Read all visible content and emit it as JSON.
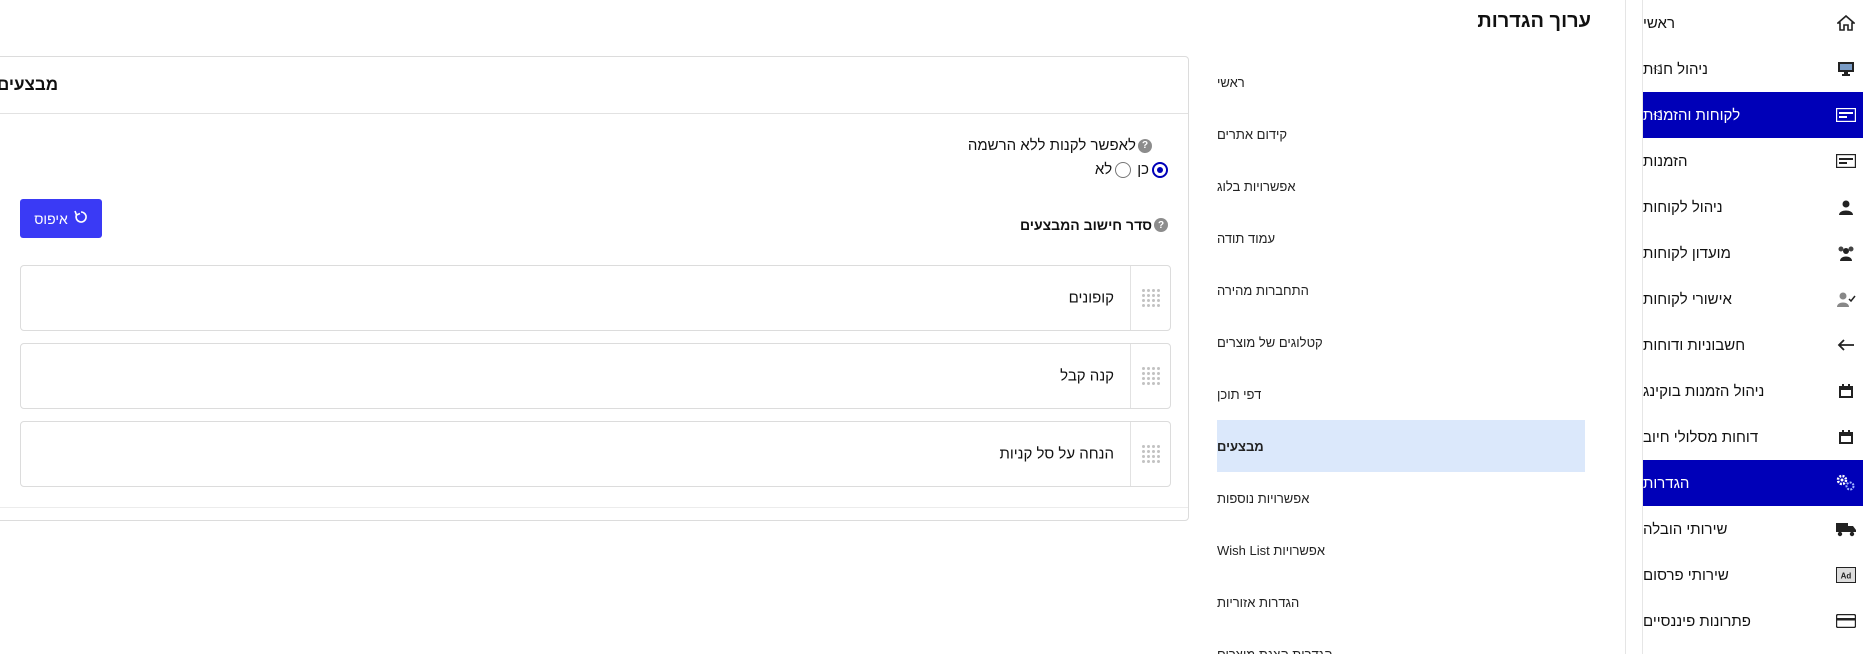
{
  "sidebar": {
    "items": [
      {
        "label": "ראשי",
        "icon": "home-icon",
        "active": false
      },
      {
        "label": "ניהול חנות",
        "icon": "monitor-icon",
        "active": false,
        "arrow": true
      },
      {
        "label": "לקוחות והזמנות",
        "icon": "id-card-icon",
        "active": true,
        "arrow": true
      },
      {
        "label": "הזמנות",
        "icon": "id-card-icon",
        "active": false
      },
      {
        "label": "ניהול לקוחות",
        "icon": "user-icon",
        "active": false
      },
      {
        "label": "מועדון לקוחות",
        "icon": "users-icon",
        "active": false
      },
      {
        "label": "אישורי לקוחות",
        "icon": "user-check-icon",
        "active": false
      },
      {
        "label": "חשבוניות ודוחות",
        "icon": "arrow-left-icon",
        "active": false
      },
      {
        "label": "ניהול הזמנות בוקינג",
        "icon": "calendar-icon",
        "active": false
      },
      {
        "label": "דוחות מסלולי חיוב",
        "icon": "calendar-icon",
        "active": false
      },
      {
        "label": "הגדרות",
        "icon": "gears-icon",
        "active": true
      },
      {
        "label": "שירותי הובלה",
        "icon": "truck-icon",
        "active": false
      },
      {
        "label": "שירותי פרסום",
        "icon": "ad-icon",
        "active": false
      },
      {
        "label": "פתרונות פיננסיים",
        "icon": "credit-card-icon",
        "active": false
      }
    ]
  },
  "page": {
    "title": "ערוך הגדרות"
  },
  "settings_nav": {
    "items": [
      {
        "label": "ראשי",
        "active": false
      },
      {
        "label": "קידום אתרים",
        "active": false
      },
      {
        "label": "אפשרויות בלוג",
        "active": false
      },
      {
        "label": "עמוד תודה",
        "active": false
      },
      {
        "label": "התחברות מהירה",
        "active": false
      },
      {
        "label": "קטלוגים של מוצרים",
        "active": false
      },
      {
        "label": "דפי תוכן",
        "active": false
      },
      {
        "label": "מבצעים",
        "active": true
      },
      {
        "label": "אפשרויות נוספות",
        "active": false
      },
      {
        "label": "אפשרויות Wish List",
        "active": false
      },
      {
        "label": "הגדרות אזוריות",
        "active": false
      },
      {
        "label": "הגדרות הצגת מוצרים",
        "active": false
      }
    ]
  },
  "panel": {
    "title": "מבצעים",
    "guest_purchase": {
      "label": "לאפשר לקנות ללא הרשמה",
      "help": "?",
      "options": [
        {
          "label": "כן",
          "checked": true
        },
        {
          "label": "לא",
          "checked": false
        }
      ]
    },
    "order": {
      "label": "סדר חישוב המבצעים",
      "help": "?",
      "reset_label": "איפוס",
      "items": [
        "קופונים",
        "קנה קבל",
        "הנחה על סל קניות"
      ]
    }
  },
  "colors": {
    "accent": "#0000b8",
    "button": "#3a3af5",
    "active_nav": "#dbe8fb"
  }
}
